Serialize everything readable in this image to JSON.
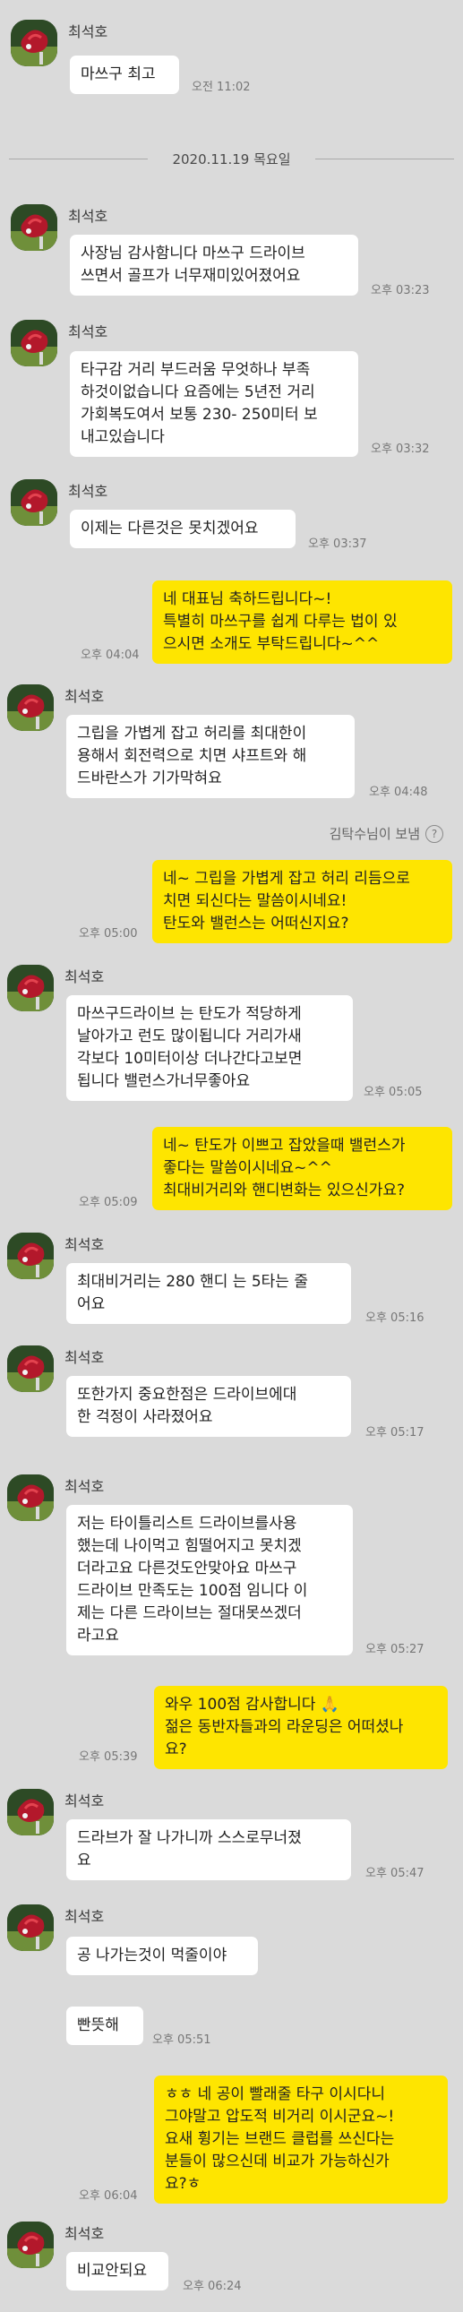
{
  "sender_name": "최석호",
  "date_divider": "2020.11.19 목요일",
  "deleted_notice": "김탁수님이 보냄",
  "help_icon": "question-circle-icon",
  "colors": {
    "background": "#dadada",
    "outgoing_bubble": "#fee500",
    "incoming_bubble": "#ffffff"
  },
  "messages": [
    {
      "dir": "in",
      "text": "마쓰구 최고",
      "time": "오전 11:02"
    },
    {
      "dir": "in",
      "text": "사장님 감사함니다 마쓰구 드라이브\n쓰면서 골프가 너무재미있어졌어요",
      "time": "오후 03:23"
    },
    {
      "dir": "in",
      "text": "타구감 거리 부드러움 무엇하나 부족\n하것이없습니다 요즘에는 5년전 거리\n가회복도여서 보통 230- 250미터 보\n내고있습니다",
      "time": "오후 03:32"
    },
    {
      "dir": "in",
      "text": "이제는 다른것은 못치겠어요",
      "time": "오후 03:37"
    },
    {
      "dir": "out",
      "text": "네 대표님 축하드립니다~!\n특별히 마쓰구를 쉽게 다루는 법이 있\n으시면 소개도 부탁드립니다~^^",
      "time": "오후 04:04"
    },
    {
      "dir": "in",
      "text": "그립을 가볍게 잡고 허리를 최대한이\n용해서 회전력으로 치면 샤프트와 해\n드바란스가 기가막혀요",
      "time": "오후 04:48"
    },
    {
      "dir": "out",
      "text": "네~ 그립을 가볍게 잡고 허리 리듬으로\n치면 되신다는 말씀이시네요!\n탄도와 밸런스는 어떠신지요?",
      "time": "오후 05:00"
    },
    {
      "dir": "in",
      "text": "마쓰구드라이브 는 탄도가 적당하게\n날아가고 런도 많이됩니다 거리가새\n각보다 10미터이상 더나간다고보면\n됩니다 밸런스가너무좋아요",
      "time": "오후 05:05"
    },
    {
      "dir": "out",
      "text": "네~ 탄도가 이쁘고 잡았을때 밸런스가\n좋다는 말씀이시네요~^^\n최대비거리와 핸디변화는 있으신가요?",
      "time": "오후 05:09"
    },
    {
      "dir": "in",
      "text": "최대비거리는 280 핸디 는 5타는 줄\n어요",
      "time": "오후 05:16"
    },
    {
      "dir": "in",
      "text": "또한가지 중요한점은 드라이브에대\n한 걱정이 사라졌어요",
      "time": "오후 05:17"
    },
    {
      "dir": "in",
      "text": "저는 타이틀리스트 드라이브를사용\n했는데 나이먹고 힘떨어지고 못치겠\n더라고요 다른것도안맞아요 마쓰구\n드라이브 만족도는 100점 임니다 이\n제는 다른 드라이브는 절대못쓰겠더\n라고요",
      "time": "오후 05:27"
    },
    {
      "dir": "out",
      "text": "와우 100점 감사합니다 🙏\n젊은 동반자들과의 라운딩은 어떠셨나\n요?",
      "time": "오후 05:39"
    },
    {
      "dir": "in",
      "text": "드라브가 잘 나가니까 스스로무너졌\n요",
      "time": "오후 05:47"
    },
    {
      "dir": "in",
      "text": "공 나가는것이 먹줄이야",
      "time": ""
    },
    {
      "dir": "in",
      "text": "빤뜻해",
      "time": "오후 05:51"
    },
    {
      "dir": "out",
      "text": "ㅎㅎ 네 공이 빨래줄 타구 이시다니\n그야말고 압도적 비거리 이시군요~!\n요새 휭기는 브랜드 클럽를 쓰신다는\n분들이 많으신데 비교가 가능하신가\n요?ㅎ",
      "time": "오후 06:04"
    },
    {
      "dir": "in",
      "text": "비교안되요",
      "time": "오후 06:24"
    }
  ]
}
